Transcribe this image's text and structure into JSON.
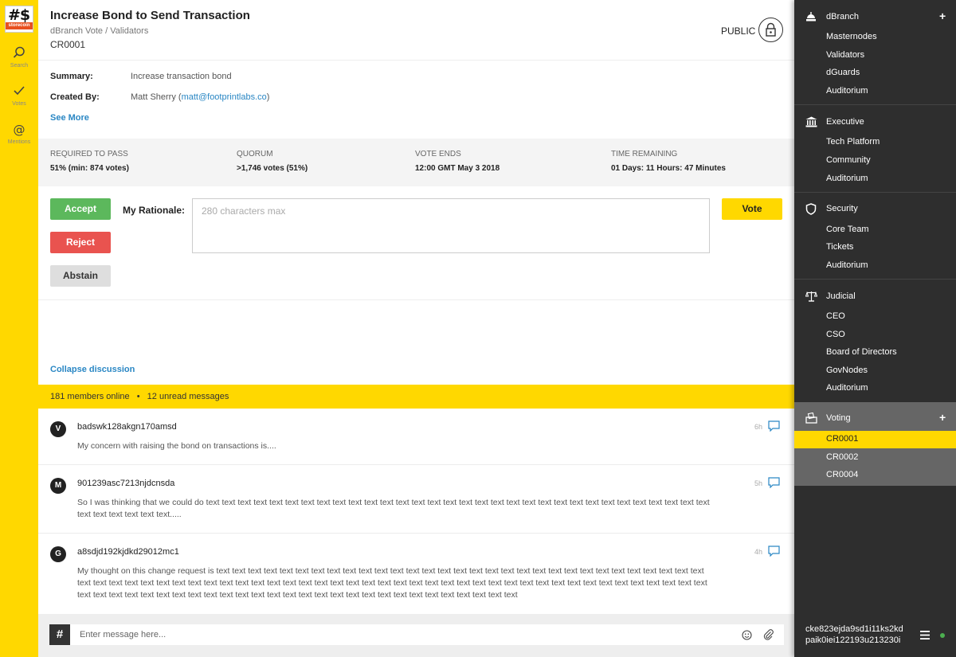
{
  "app": {
    "logo_text": "storecoin"
  },
  "leftnav": [
    {
      "icon": "search-icon",
      "label": "Search"
    },
    {
      "icon": "check-icon",
      "label": "Votes"
    },
    {
      "icon": "at-icon",
      "label": "Mentions"
    }
  ],
  "header": {
    "title": "Increase Bond to Send Transaction",
    "breadcrumb": "dBranch Vote / Validators",
    "code": "CR0001",
    "visibility": "PUBLIC"
  },
  "details": {
    "summary_label": "Summary:",
    "summary_value": "Increase transaction bond",
    "created_label": "Created By:",
    "created_name": "Matt Sherry (",
    "created_email": "matt@footprintlabs.co",
    "created_close": ")",
    "see_more": "See More"
  },
  "stats": [
    {
      "label": "REQUIRED TO PASS",
      "value": "51% (min: 874 votes)"
    },
    {
      "label": "QUORUM",
      "value": ">1,746 votes (51%)"
    },
    {
      "label": "VOTE ENDS",
      "value": "12:00 GMT May 3 2018"
    },
    {
      "label": "TIME REMAINING",
      "value": "01 Days: 11 Hours: 47 Minutes"
    }
  ],
  "vote": {
    "accept": "Accept",
    "reject": "Reject",
    "abstain": "Abstain",
    "rationale_label": "My Rationale:",
    "rationale_placeholder": "280 characters max",
    "vote_button": "Vote"
  },
  "discussion": {
    "collapse": "Collapse discussion",
    "online": "181 members online",
    "separator": "•",
    "unread": "12 unread messages",
    "messages": [
      {
        "initial": "V",
        "user": "badswk128akgn170amsd",
        "time": "6h",
        "text": "My concern with raising the bond on transactions is...."
      },
      {
        "initial": "M",
        "user": "901239asc7213njdcnsda",
        "time": "5h",
        "text": "So I was thinking that we could do text text text text text text text text text text text text text text text text text text text text text text text text text text text text text text text text text text text text text text....."
      },
      {
        "initial": "G",
        "user": "a8sdjd192kjdkd29012mc1",
        "time": "4h",
        "text": "My thought on this change request is text text text text text text text text text text text text text text text text text text text text text text text text text text text text text text text text text text text text text text text text text text text text text text text text text text text text text text text text text text text text text text text text text text text text text text text text text text text text text text text text text text text text text text text text text text text text text text text text text text text"
      }
    ]
  },
  "composer": {
    "hash": "#",
    "placeholder": "Enter message here..."
  },
  "sidebar": {
    "sections": [
      {
        "title": "dBranch",
        "icon": "dome-icon",
        "plus": "+",
        "items": [
          "Masternodes",
          "Validators",
          "dGuards",
          "Auditorium"
        ]
      },
      {
        "title": "Executive",
        "icon": "bank-icon",
        "items": [
          "Tech Platform",
          "Community",
          "Auditorium"
        ]
      },
      {
        "title": "Security",
        "icon": "shield-icon",
        "items": [
          "Core Team",
          "Tickets",
          "Auditorium"
        ]
      },
      {
        "title": "Judicial",
        "icon": "scales-icon",
        "items": [
          "CEO",
          "CSO",
          "Board of Directors",
          "GovNodes",
          "Auditorium"
        ]
      },
      {
        "title": "Voting",
        "icon": "ballot-box-icon",
        "plus": "+",
        "items": [
          "CR0001",
          "CR0002",
          "CR0004"
        ]
      }
    ],
    "selected_item": "CR0001",
    "user": {
      "line1": "cke823ejda9sd1i11ks2kd",
      "line2": "paik0iei122193u213230i"
    }
  },
  "colors": {
    "accent": "#FFD800",
    "link": "#2A87C4",
    "accept": "#5CB85C",
    "reject": "#E9534F",
    "sidebar_bg": "#2E2E2E",
    "voting_bg": "#666666",
    "online": "#4CAF50"
  }
}
